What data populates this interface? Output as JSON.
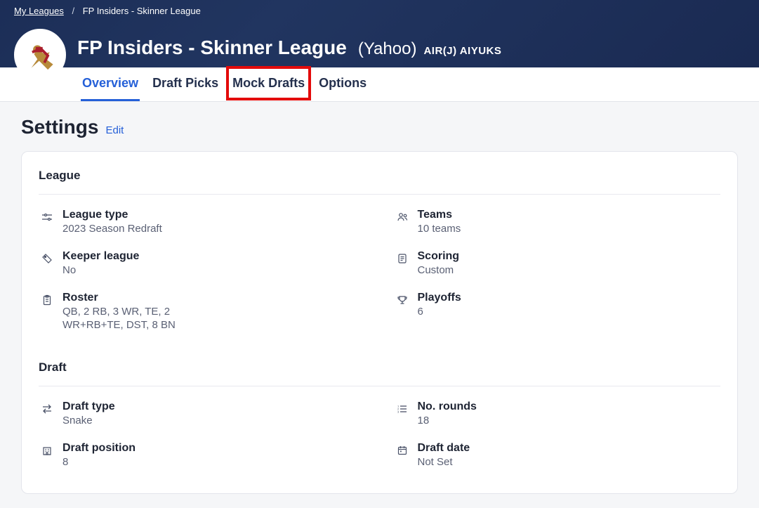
{
  "breadcrumb": {
    "root": "My Leagues",
    "current": "FP Insiders - Skinner League"
  },
  "header": {
    "league_name": "FP Insiders - Skinner League",
    "provider": "(Yahoo)",
    "team_name": "AIR(J) AIYUKS"
  },
  "tabs": {
    "overview": "Overview",
    "draft_picks": "Draft Picks",
    "mock_drafts": "Mock Drafts",
    "options": "Options"
  },
  "settings": {
    "title": "Settings",
    "edit": "Edit",
    "league_section": "League",
    "draft_section": "Draft",
    "league_type_label": "League type",
    "league_type_value": "2023 Season Redraft",
    "teams_label": "Teams",
    "teams_value": "10 teams",
    "keeper_label": "Keeper league",
    "keeper_value": "No",
    "scoring_label": "Scoring",
    "scoring_value": "Custom",
    "roster_label": "Roster",
    "roster_value_l1": "QB, 2 RB, 3 WR, TE, 2",
    "roster_value_l2": "WR+RB+TE, DST, 8 BN",
    "playoffs_label": "Playoffs",
    "playoffs_value": "6",
    "draft_type_label": "Draft type",
    "draft_type_value": "Snake",
    "rounds_label": "No. rounds",
    "rounds_value": "18",
    "position_label": "Draft position",
    "position_value": "8",
    "date_label": "Draft date",
    "date_value": "Not Set"
  }
}
